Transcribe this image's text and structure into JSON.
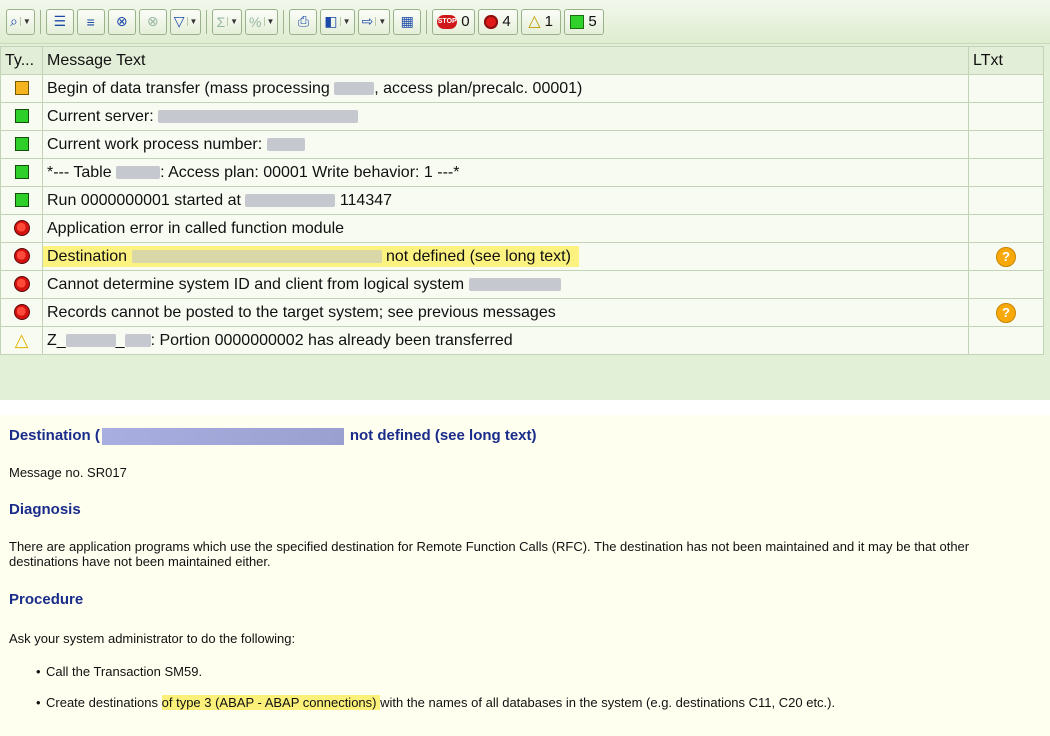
{
  "toolbar": {
    "buttons": [
      {
        "name": "details-button",
        "icon": "glasses-icon"
      },
      {
        "name": "sort-ascending-button",
        "icon": "sort-ascending-icon"
      },
      {
        "name": "sort-descending-button",
        "icon": "sort-descending-icon"
      },
      {
        "name": "find-button",
        "icon": "binoculars-icon"
      },
      {
        "name": "find-next-button",
        "icon": "binoculars-next-icon"
      },
      {
        "name": "filter-button",
        "icon": "filter-icon"
      },
      {
        "name": "total-button",
        "icon": "sigma-icon"
      },
      {
        "name": "subtotal-button",
        "icon": "subtotal-icon"
      },
      {
        "name": "print-button",
        "icon": "print-icon"
      },
      {
        "name": "change-layout-button",
        "icon": "layout-icon"
      },
      {
        "name": "export-button",
        "icon": "export-icon"
      },
      {
        "name": "grid-button",
        "icon": "grid-icon"
      }
    ],
    "counts": {
      "stop": "0",
      "error": "4",
      "warning": "1",
      "success": "5"
    }
  },
  "log": {
    "headers": {
      "type": "Ty...",
      "message": "Message Text",
      "ltxt": "LTxt"
    },
    "rows": [
      {
        "type": "info",
        "pre": "Begin of data transfer (mass processing ",
        "post": ", access plan/precalc. 00001)",
        "long": false
      },
      {
        "type": "success",
        "pre": "Current server: ",
        "post": "",
        "long": false
      },
      {
        "type": "success",
        "pre": "Current work process number: ",
        "post": "",
        "long": false
      },
      {
        "type": "success",
        "pre": "*--- Table ",
        "post": ": Access plan: 00001 Write behavior: 1 ---*",
        "long": false
      },
      {
        "type": "success",
        "pre": "Run 0000000001 started at ",
        "post": " 114347",
        "long": false
      },
      {
        "type": "error",
        "pre": "Application error in called function module",
        "post": "",
        "long": false
      },
      {
        "type": "error",
        "pre": "Destination ",
        "post": " not defined (see long text)",
        "long": true
      },
      {
        "type": "error",
        "pre": "Cannot determine system ID and client from logical system ",
        "post": "",
        "long": false
      },
      {
        "type": "error",
        "pre": "Records cannot be posted to the target system; see previous messages",
        "post": "",
        "long": true
      },
      {
        "type": "warning",
        "pre": "Z_",
        "mid": "_",
        "post": ": Portion 0000000002 has already been transferred",
        "long": false
      }
    ]
  },
  "longtext": {
    "title_pre": "Destination (",
    "title_post": "not defined (see long text)",
    "message_no": "Message no. SR017",
    "diagnosis_heading": "Diagnosis",
    "diagnosis_text": "There are application programs which use the specified destination for Remote Function Calls (RFC). The destination has not been maintained and it may be that other destinations have not been maintained either.",
    "procedure_heading": "Procedure",
    "procedure_intro": "Ask your system administrator to do the following:",
    "bullet1": "Call the Transaction SM59.",
    "bullet2_pre": "Create destinations ",
    "bullet2_mark": "of type 3 (ABAP - ABAP connections) ",
    "bullet2_post": "with the names of all databases in the system (e.g. destinations C11, C20 etc.)."
  }
}
